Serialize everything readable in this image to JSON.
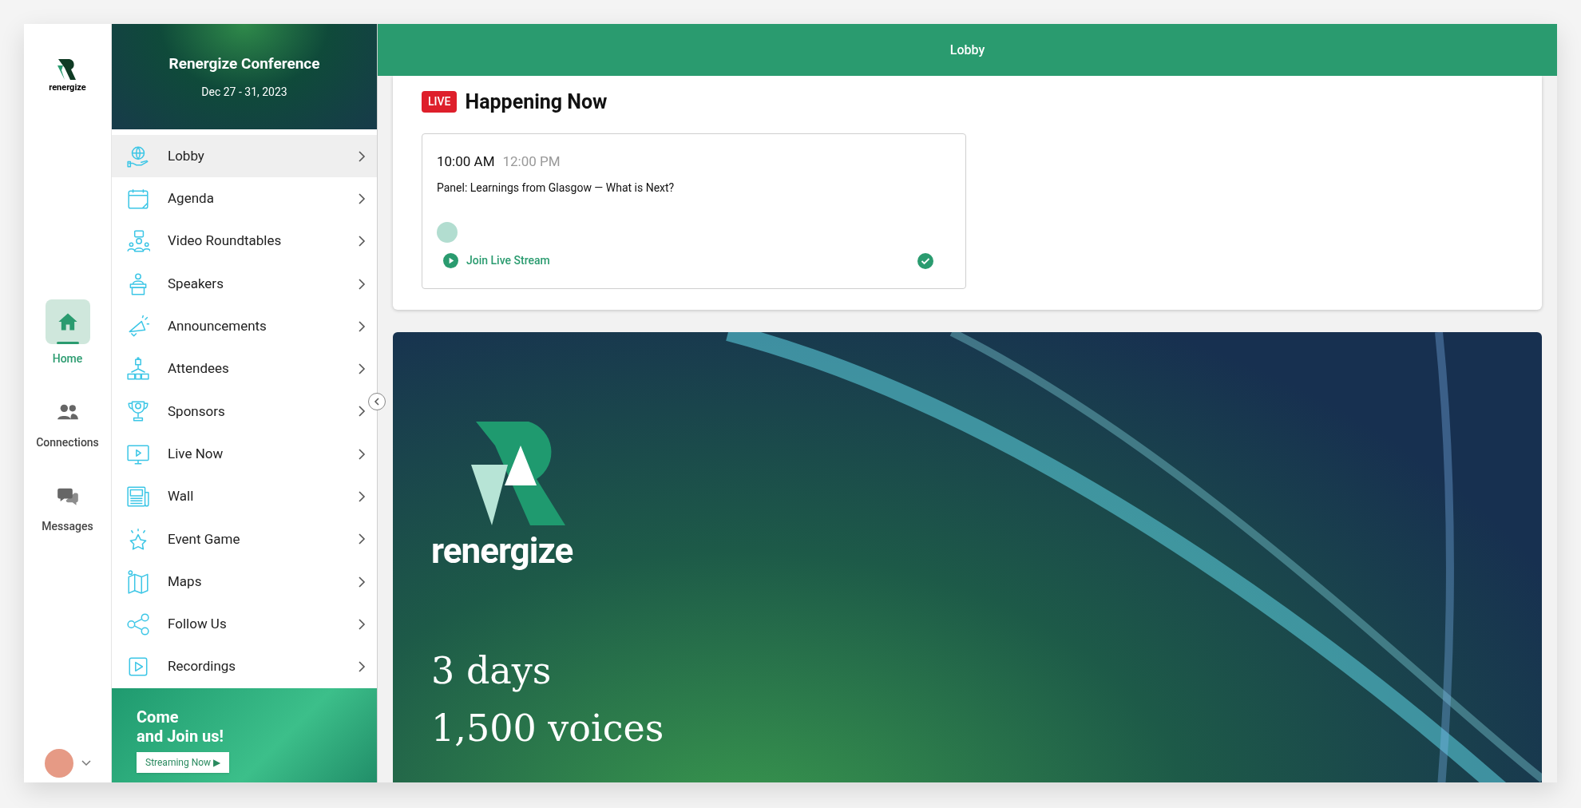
{
  "rail": {
    "logo_text": "renergize",
    "items": [
      {
        "label": "Home",
        "selected": true
      },
      {
        "label": "Connections",
        "selected": false
      },
      {
        "label": "Messages",
        "selected": false
      }
    ]
  },
  "sidebar": {
    "title": "Renergize Conference",
    "dates": "Dec 27 - 31, 2023",
    "items": [
      {
        "label": "Lobby",
        "selected": true
      },
      {
        "label": "Agenda",
        "selected": false
      },
      {
        "label": "Video Roundtables",
        "selected": false
      },
      {
        "label": "Speakers",
        "selected": false
      },
      {
        "label": "Announcements",
        "selected": false
      },
      {
        "label": "Attendees",
        "selected": false
      },
      {
        "label": "Sponsors",
        "selected": false
      },
      {
        "label": "Live Now",
        "selected": false
      },
      {
        "label": "Wall",
        "selected": false
      },
      {
        "label": "Event Game",
        "selected": false
      },
      {
        "label": "Maps",
        "selected": false
      },
      {
        "label": "Follow Us",
        "selected": false
      },
      {
        "label": "Recordings",
        "selected": false
      }
    ],
    "promo": {
      "headline_1": "Come",
      "headline_2": "and Join us!",
      "button": "Streaming Now ▶"
    }
  },
  "header": {
    "title": "Lobby"
  },
  "happening_now": {
    "badge": "LIVE",
    "title": "Happening Now",
    "session": {
      "start": "10:00 AM",
      "end": "12:00 PM",
      "title": "Panel: Learnings from Glasgow — What is Next?",
      "link": "Join Live Stream",
      "joined": true
    }
  },
  "banner": {
    "logo_text": "renergize",
    "lines": [
      "3 days",
      "1,500 voices"
    ]
  }
}
